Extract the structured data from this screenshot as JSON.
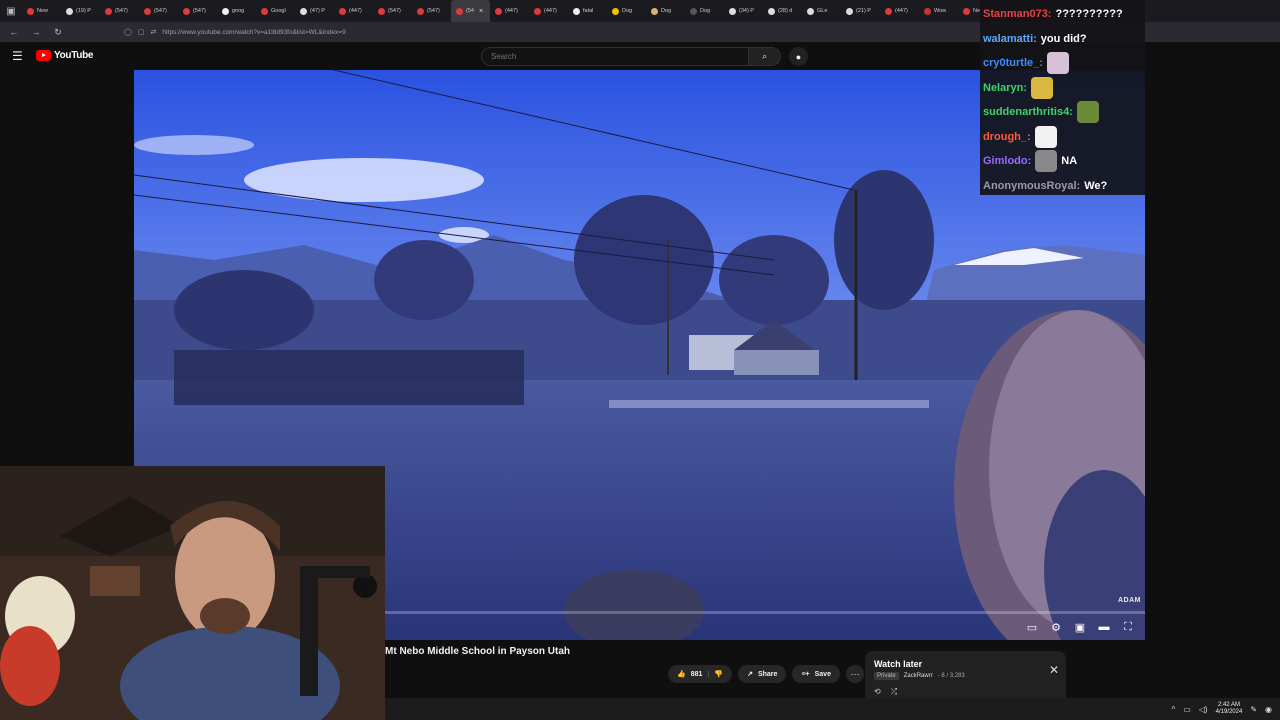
{
  "browser": {
    "tabs": [
      {
        "label": "New",
        "color": "#e03a3a"
      },
      {
        "label": "(19) P",
        "color": "#dddddd"
      },
      {
        "label": "(547)",
        "color": "#e03a3a"
      },
      {
        "label": "(547)",
        "color": "#e03a3a"
      },
      {
        "label": "(547)",
        "color": "#e03a3a"
      },
      {
        "label": "goog",
        "color": "#eeeeee"
      },
      {
        "label": "Googl",
        "color": "#e03a3a"
      },
      {
        "label": "(47) P",
        "color": "#dddddd"
      },
      {
        "label": "(447)",
        "color": "#e03a3a"
      },
      {
        "label": "(547)",
        "color": "#e03a3a"
      },
      {
        "label": "(547)",
        "color": "#e03a3a"
      },
      {
        "label": "(54",
        "color": "#e03a3a",
        "active": true
      },
      {
        "label": "(447)",
        "color": "#e03a3a"
      },
      {
        "label": "(447)",
        "color": "#e03a3a"
      },
      {
        "label": "fatal",
        "color": "#eeeeee"
      },
      {
        "label": "Dog",
        "color": "#f0c000"
      },
      {
        "label": "Dog",
        "color": "#d8b070"
      },
      {
        "label": "Dog",
        "color": "#555555"
      },
      {
        "label": "(34) P",
        "color": "#dddddd"
      },
      {
        "label": "(28) d",
        "color": "#dddddd"
      },
      {
        "label": "GLe",
        "color": "#dddddd"
      },
      {
        "label": "(21) P",
        "color": "#dddddd"
      },
      {
        "label": "(447)",
        "color": "#e03a3a"
      },
      {
        "label": "Wow",
        "color": "#c0392b"
      },
      {
        "label": "Ne",
        "color": "#e03a3a"
      }
    ],
    "tab_close": "×",
    "url": "https://www.youtube.com/watch?v=a1l8d93fo&list=WL&index=9"
  },
  "youtube": {
    "logo_text": "YouTube",
    "search_placeholder": "Search",
    "video_title": "Mt Nebo Middle School in Payson Utah",
    "watermark": "ADAM",
    "like_count": "881",
    "share_label": "Share",
    "save_label": "Save",
    "watch_later": {
      "title": "Watch later",
      "privacy": "Private",
      "owner": "ZackRawrr",
      "position": "- 8 / 3,283"
    }
  },
  "chat": [
    {
      "user": "Stanman073:",
      "color": "#e8413f",
      "message": "??????????",
      "emote": null
    },
    {
      "user": "walamatti:",
      "color": "#5aa9ff",
      "message": "you did?",
      "emote": null
    },
    {
      "user": "cry0turtle_:",
      "color": "#3c8cff",
      "message": "",
      "emote": "#d8c0d8"
    },
    {
      "user": "Nelaryn:",
      "color": "#3fd46a",
      "message": "",
      "emote": "#d8b840"
    },
    {
      "user": "suddenarthritis4:",
      "color": "#3fd46a",
      "message": "",
      "emote": "#6a8a3a"
    },
    {
      "user": "drough_:",
      "color": "#ff5a36",
      "message": "",
      "emote": "#f2f2f2"
    },
    {
      "user": "Gimlodo:",
      "color": "#9b6bff",
      "message": "NA",
      "emote": "#888888"
    },
    {
      "user": "AnonymousRoyal:",
      "color": "#9a9aa8",
      "message": "We?",
      "emote": null
    }
  ],
  "taskbar": {
    "time": "2:42 AM",
    "date": "4/19/2024"
  }
}
